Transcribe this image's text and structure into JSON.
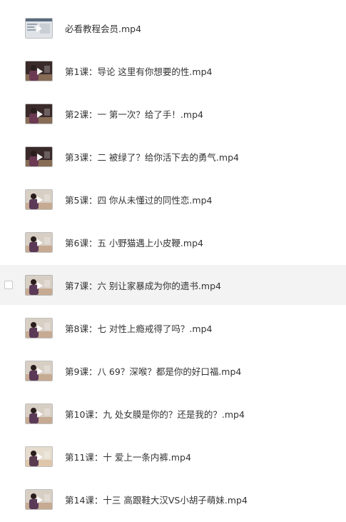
{
  "files": [
    {
      "name": "必看教程会员.mp4",
      "thumb": "screen",
      "selected": false,
      "hovered": false
    },
    {
      "name": "第1课：导论 这里有你想要的性.mp4",
      "thumb": "dark",
      "selected": false,
      "hovered": false
    },
    {
      "name": "第2课：一 第一次？给了手！.mp4",
      "thumb": "dark",
      "selected": false,
      "hovered": false
    },
    {
      "name": "第3课：二 被绿了？给你活下去的勇气.mp4",
      "thumb": "dark",
      "selected": false,
      "hovered": false
    },
    {
      "name": "第5课：四 你从未懂过的同性恋.mp4",
      "thumb": "light",
      "selected": false,
      "hovered": false
    },
    {
      "name": "第6课：五 小野猫遇上小皮鞭.mp4",
      "thumb": "light",
      "selected": false,
      "hovered": false
    },
    {
      "name": "第7课：六 别让家暴成为你的遗书.mp4",
      "thumb": "light",
      "selected": false,
      "hovered": true
    },
    {
      "name": "第8课：七 对性上瘾戒得了吗？.mp4",
      "thumb": "light",
      "selected": false,
      "hovered": false
    },
    {
      "name": "第9课：八 69？深喉？都是你的好口福.mp4",
      "thumb": "light",
      "selected": false,
      "hovered": false
    },
    {
      "name": "第10课：九 处女膜是你的？还是我的？.mp4",
      "thumb": "light",
      "selected": false,
      "hovered": false
    },
    {
      "name": "第11课：十 爱上一条内裤.mp4",
      "thumb": "beige",
      "selected": false,
      "hovered": false
    },
    {
      "name": "第14课：十三 高跟鞋大汉VS小胡子萌妹.mp4",
      "thumb": "light",
      "selected": false,
      "hovered": false
    }
  ],
  "colors": {
    "text": "#333333",
    "hover_bg": "#f3f3f3",
    "checkbox_border": "#c8c8c8"
  },
  "icons": {
    "thumbnail": "video-thumbnail-icon",
    "play": "play-icon",
    "checkbox": "checkbox-icon"
  }
}
